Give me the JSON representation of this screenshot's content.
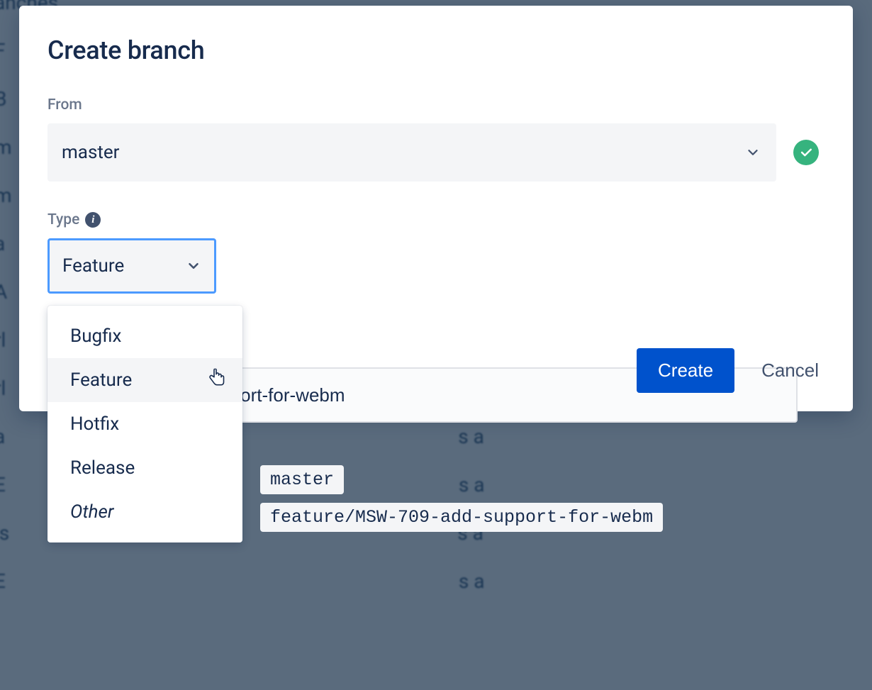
{
  "modal": {
    "title": "Create branch",
    "from_label": "From",
    "from_value": "master",
    "type_label": "Type",
    "type_value": "Feature",
    "type_options": [
      {
        "label": "Bugfix",
        "italic": false
      },
      {
        "label": "Feature",
        "italic": false,
        "hovered": true
      },
      {
        "label": "Hotfix",
        "italic": false
      },
      {
        "label": "Release",
        "italic": false
      },
      {
        "label": "Other",
        "italic": true
      }
    ],
    "branch_name_value": "MSW-709-add-support-for-webm",
    "source_ref": "master",
    "target_ref": "feature/MSW-709-add-support-for-webm",
    "create_label": "Create",
    "cancel_label": "Cancel"
  },
  "colors": {
    "primary": "#0052CC",
    "success": "#36B37E",
    "focus": "#4C9AFF",
    "subtle_bg": "#F4F5F7"
  }
}
